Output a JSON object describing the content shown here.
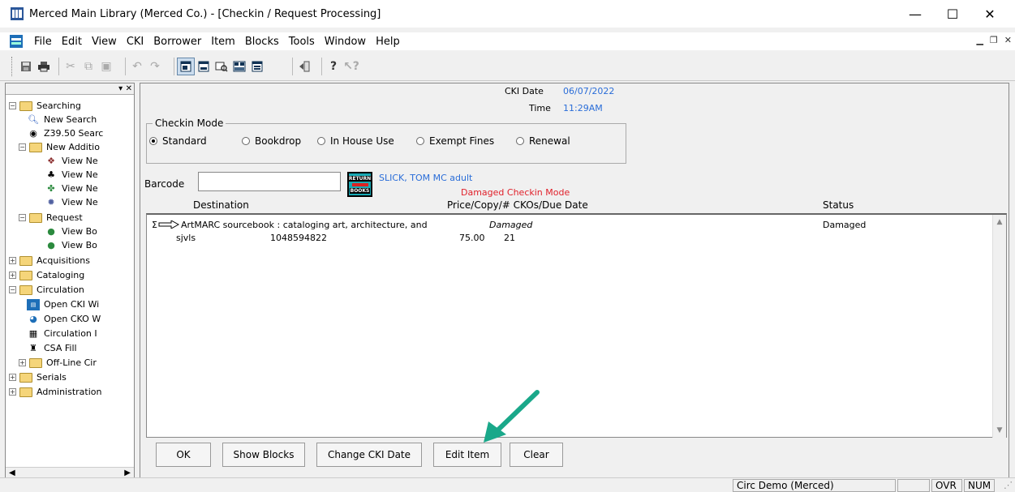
{
  "window": {
    "title": "Merced Main Library (Merced Co.) - [Checkin / Request Processing]",
    "minimize": "—",
    "maximize": "☐",
    "close": "✕"
  },
  "menu": [
    "File",
    "Edit",
    "View",
    "CKI",
    "Borrower",
    "Item",
    "Blocks",
    "Tools",
    "Window",
    "Help"
  ],
  "tree": {
    "searching": "Searching",
    "new_search": "New Search",
    "z3950": "Z39.50 Searc",
    "new_additions": "New Additio",
    "view_ne_1": "View Ne",
    "view_ne_2": "View Ne",
    "view_ne_3": "View Ne",
    "view_ne_4": "View Ne",
    "request": "Request",
    "view_bo_1": "View Bo",
    "view_bo_2": "View Bo",
    "acquisitions": "Acquisitions",
    "cataloging": "Cataloging",
    "circulation": "Circulation",
    "open_cki": "Open CKI Wi",
    "open_cko": "Open CKO W",
    "circulation_i": "Circulation I",
    "csa_fill": "CSA Fill",
    "offline": "Off-Line Cir",
    "serials": "Serials",
    "administration": "Administration"
  },
  "checkin": {
    "cki_date_label": "CKI Date",
    "cki_date": "06/07/2022",
    "time_label": "Time",
    "time": "11:29AM",
    "mode_legend": "Checkin Mode",
    "modes": [
      "Standard",
      "Bookdrop",
      "In House Use",
      "Exempt Fines",
      "Renewal"
    ],
    "barcode_label": "Barcode",
    "barcode_value": "",
    "return_icon_top": "RETURN",
    "return_icon_bottom": "BOOKS",
    "patron": "SLICK, TOM MC adult",
    "damaged_mode": "Damaged Checkin Mode",
    "columns": {
      "destination": "Destination",
      "price": "Price/Copy/# CKOs/Due Date",
      "status": "Status"
    },
    "item": {
      "title": "ArtMARC sourcebook : cataloging art, architecture, and",
      "condition": "Damaged",
      "status": "Damaged",
      "location": "sjvls",
      "barcode": "1048594822",
      "price": "75.00",
      "ckos": "21"
    }
  },
  "buttons": {
    "ok": "OK",
    "show_blocks": "Show Blocks",
    "change_cki_date": "Change CKI Date",
    "edit_item": "Edit Item",
    "clear": "Clear"
  },
  "status_bar": {
    "location": "Circ Demo (Merced)",
    "ovr": "OVR",
    "num": "NUM"
  },
  "colors": {
    "link_blue": "#2a6dd8",
    "alert_red": "#e0202a",
    "annotation_arrow": "#1aa88a"
  }
}
